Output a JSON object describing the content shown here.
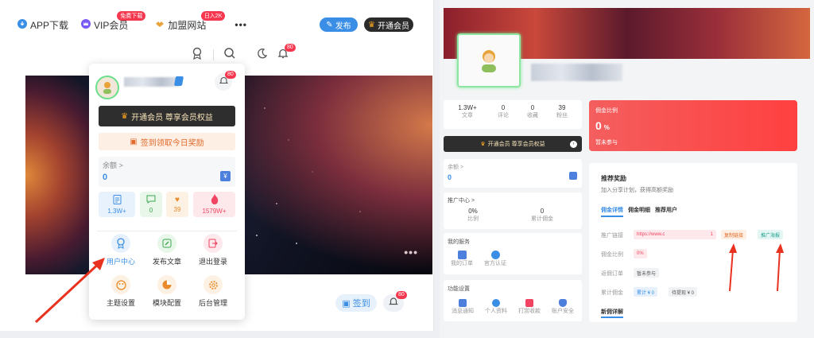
{
  "nav": {
    "app": "APP下载",
    "vip": "VIP会员",
    "vip_badge": "免费下载",
    "join": "加盟网站",
    "join_badge": "日入2K",
    "publish": "发布",
    "open_vip": "开通会员",
    "notif_count": "80"
  },
  "popup": {
    "bell_count": "80",
    "vip_bar": "开通会员 尊享会员权益",
    "sign_bar": "签到领取今日奖励",
    "balance_label": "余额 >",
    "balance_value": "0",
    "stats": [
      {
        "value": "1.3W+"
      },
      {
        "value": "0"
      },
      {
        "value": "39"
      },
      {
        "value": "1579W+"
      }
    ],
    "grid": [
      {
        "label": "用户中心"
      },
      {
        "label": "发布文章"
      },
      {
        "label": "退出登录"
      },
      {
        "label": "主题设置"
      },
      {
        "label": "模块配置"
      },
      {
        "label": "后台管理"
      }
    ]
  },
  "banner_bottom": {
    "sign": "签到",
    "bell_count": "80"
  },
  "right": {
    "stats": [
      {
        "value": "1.3W+",
        "label": "文章"
      },
      {
        "value": "0",
        "label": "评论"
      },
      {
        "value": "0",
        "label": "收藏"
      },
      {
        "value": "39",
        "label": "粉丝"
      }
    ],
    "vip_bar": "开通会员 尊享会员权益",
    "balance_label": "余额 >",
    "balance_value": "0",
    "promo_label": "推广中心 >",
    "promo_rate": "0%",
    "promo_rate_label": "比例",
    "promo_total": "0",
    "promo_total_label": "累计佣金",
    "services_title": "我的服务",
    "services": [
      {
        "label": "我的订单"
      },
      {
        "label": "官方认证"
      }
    ],
    "settings_title": "功能设置",
    "settings": [
      {
        "label": "消息通知"
      },
      {
        "label": "个人资料"
      },
      {
        "label": "打赏收款"
      },
      {
        "label": "账户安全"
      }
    ],
    "red_title": "佣金比例",
    "red_value": "0",
    "red_unit": "%",
    "red_sub": "暂未参与",
    "rec_title": "推荐奖励",
    "rec_sub": "加入分享计划，获得高额奖励",
    "tabs": [
      {
        "label": "佣金详情"
      },
      {
        "label": "佣金明细"
      },
      {
        "label": "推荐用户"
      }
    ],
    "row_link_label": "推广链接",
    "row_link_value": "https://www.c",
    "row_link_count": "1",
    "copy_btn": "复制链接",
    "poster_btn": "推广海报",
    "row_rate_label": "佣金比例",
    "row_rate_value": "0%",
    "row_order_label": "返佣订单",
    "row_order_value": "暂未参与",
    "row_total_label": "累计佣金",
    "row_total_value": "累计 ¥ 0",
    "row_pending_value": "待提现 ¥ 0",
    "new_detail": "新佣详解"
  },
  "colors": {
    "accent": "#3a8ee6",
    "red": "#f5374f",
    "vip_dark": "#2e2e2e",
    "arrow": "#e8321f"
  }
}
